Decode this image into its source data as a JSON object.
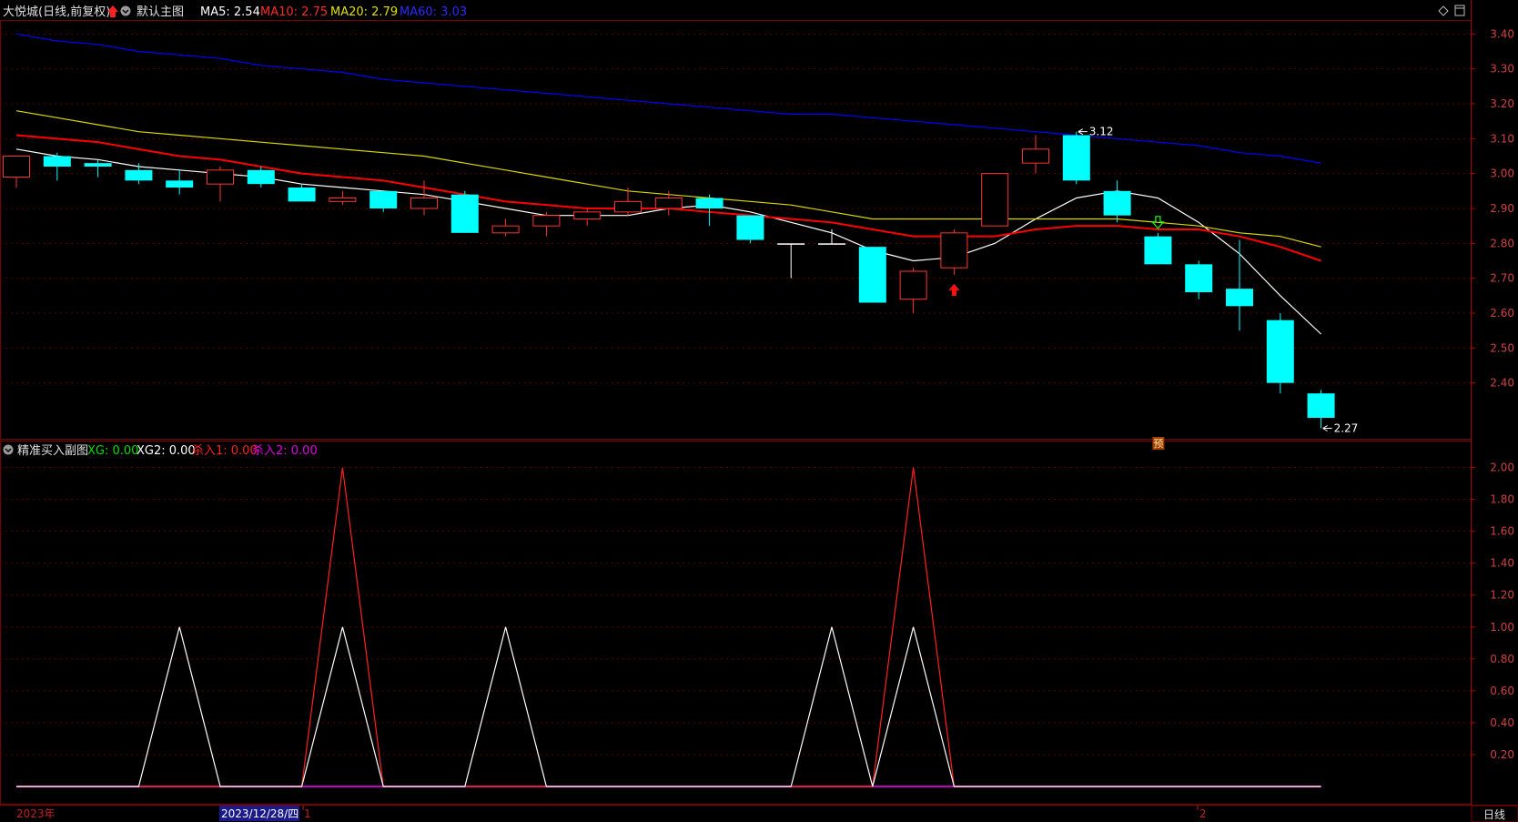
{
  "main_header": {
    "title": "大悦城(日线,前复权)",
    "indicator_name": "默认主图",
    "ma5": "MA5: 2.54",
    "ma10": "MA10: 2.75",
    "ma20": "MA20: 2.79",
    "ma60": "MA60: 3.03"
  },
  "sub_header": {
    "title": "精准买入副图",
    "xg": "XG: 0.00",
    "xg2": "XG2: 0.00",
    "sell1": "杀入1: 0.00",
    "sell2": "杀入2: 0.00"
  },
  "bottom_bar": {
    "year_label": "2023年",
    "date_label": "2023/12/28/四",
    "month1": "1",
    "month2": "2",
    "period_button": "日线"
  },
  "colors": {
    "up": "#ff3232",
    "down": "#00ffff",
    "ma5": "#ffffff",
    "ma10": "#ff0000",
    "ma20": "#d8d800",
    "ma60": "#0000ff",
    "axis": "#b00000",
    "sub_red": "#ff2020",
    "sub_white": "#ffffff",
    "sub_purple": "#c000c0"
  },
  "chart_data": [
    {
      "type": "candlestick",
      "title": "大悦城(日线,前复权)",
      "ylim": [
        2.24,
        3.44
      ],
      "y_ticks": [
        "3.40",
        "3.30",
        "3.20",
        "3.10",
        "3.00",
        "2.90",
        "2.80",
        "2.70",
        "2.60",
        "2.50",
        "2.40"
      ],
      "candles": [
        {
          "o": 2.99,
          "h": 3.01,
          "l": 2.96,
          "c": 3.05
        },
        {
          "o": 3.05,
          "h": 3.06,
          "l": 2.98,
          "c": 3.02
        },
        {
          "o": 3.03,
          "h": 3.04,
          "l": 2.99,
          "c": 3.02
        },
        {
          "o": 3.01,
          "h": 3.03,
          "l": 2.97,
          "c": 2.98
        },
        {
          "o": 2.98,
          "h": 3.01,
          "l": 2.94,
          "c": 2.96
        },
        {
          "o": 2.97,
          "h": 3.02,
          "l": 2.92,
          "c": 3.01
        },
        {
          "o": 3.01,
          "h": 3.02,
          "l": 2.96,
          "c": 2.97
        },
        {
          "o": 2.96,
          "h": 2.97,
          "l": 2.92,
          "c": 2.92
        },
        {
          "o": 2.92,
          "h": 2.95,
          "l": 2.91,
          "c": 2.93
        },
        {
          "o": 2.95,
          "h": 2.95,
          "l": 2.89,
          "c": 2.9
        },
        {
          "o": 2.9,
          "h": 2.98,
          "l": 2.88,
          "c": 2.93
        },
        {
          "o": 2.94,
          "h": 2.95,
          "l": 2.83,
          "c": 2.83
        },
        {
          "o": 2.83,
          "h": 2.87,
          "l": 2.82,
          "c": 2.85
        },
        {
          "o": 2.85,
          "h": 2.89,
          "l": 2.82,
          "c": 2.88
        },
        {
          "o": 2.87,
          "h": 2.9,
          "l": 2.85,
          "c": 2.89
        },
        {
          "o": 2.89,
          "h": 2.96,
          "l": 2.88,
          "c": 2.92
        },
        {
          "o": 2.9,
          "h": 2.95,
          "l": 2.88,
          "c": 2.93
        },
        {
          "o": 2.93,
          "h": 2.94,
          "l": 2.85,
          "c": 2.9
        },
        {
          "o": 2.88,
          "h": 2.88,
          "l": 2.8,
          "c": 2.81
        },
        {
          "o": 2.8,
          "h": 2.8,
          "l": 2.7,
          "c": 2.8
        },
        {
          "o": 2.8,
          "h": 2.84,
          "l": 2.8,
          "c": 2.8
        },
        {
          "o": 2.79,
          "h": 2.79,
          "l": 2.63,
          "c": 2.63
        },
        {
          "o": 2.64,
          "h": 2.73,
          "l": 2.6,
          "c": 2.72
        },
        {
          "o": 2.73,
          "h": 2.84,
          "l": 2.71,
          "c": 2.83
        },
        {
          "o": 2.85,
          "h": 3.0,
          "l": 2.85,
          "c": 3.0
        },
        {
          "o": 3.03,
          "h": 3.11,
          "l": 3.0,
          "c": 3.07
        },
        {
          "o": 3.11,
          "h": 3.12,
          "l": 2.97,
          "c": 2.98
        },
        {
          "o": 2.95,
          "h": 2.98,
          "l": 2.86,
          "c": 2.88
        },
        {
          "o": 2.82,
          "h": 2.83,
          "l": 2.74,
          "c": 2.74
        },
        {
          "o": 2.74,
          "h": 2.75,
          "l": 2.64,
          "c": 2.66
        },
        {
          "o": 2.67,
          "h": 2.81,
          "l": 2.55,
          "c": 2.62
        },
        {
          "o": 2.58,
          "h": 2.6,
          "l": 2.37,
          "c": 2.4
        },
        {
          "o": 2.37,
          "h": 2.38,
          "l": 2.27,
          "c": 2.3
        }
      ],
      "series": [
        {
          "name": "MA5",
          "values": [
            3.07,
            3.05,
            3.04,
            3.02,
            3.01,
            3.0,
            2.99,
            2.97,
            2.96,
            2.95,
            2.94,
            2.92,
            2.9,
            2.88,
            2.88,
            2.88,
            2.9,
            2.91,
            2.89,
            2.86,
            2.83,
            2.78,
            2.75,
            2.76,
            2.8,
            2.87,
            2.93,
            2.95,
            2.93,
            2.86,
            2.77,
            2.65,
            2.54
          ]
        },
        {
          "name": "MA10",
          "values": [
            3.11,
            3.1,
            3.09,
            3.07,
            3.05,
            3.04,
            3.02,
            3.0,
            2.99,
            2.98,
            2.96,
            2.94,
            2.92,
            2.91,
            2.9,
            2.9,
            2.9,
            2.89,
            2.88,
            2.87,
            2.86,
            2.84,
            2.82,
            2.82,
            2.82,
            2.84,
            2.85,
            2.85,
            2.84,
            2.84,
            2.82,
            2.79,
            2.75
          ]
        },
        {
          "name": "MA20",
          "values": [
            3.18,
            3.16,
            3.14,
            3.12,
            3.11,
            3.1,
            3.09,
            3.08,
            3.07,
            3.06,
            3.05,
            3.03,
            3.01,
            2.99,
            2.97,
            2.95,
            2.94,
            2.93,
            2.92,
            2.91,
            2.89,
            2.87,
            2.87,
            2.87,
            2.87,
            2.87,
            2.87,
            2.87,
            2.86,
            2.85,
            2.83,
            2.82,
            2.79
          ]
        },
        {
          "name": "MA60",
          "values": [
            3.4,
            3.38,
            3.37,
            3.35,
            3.34,
            3.33,
            3.31,
            3.3,
            3.29,
            3.27,
            3.26,
            3.25,
            3.24,
            3.23,
            3.22,
            3.21,
            3.2,
            3.19,
            3.18,
            3.17,
            3.17,
            3.16,
            3.15,
            3.14,
            3.13,
            3.12,
            3.11,
            3.1,
            3.09,
            3.08,
            3.06,
            3.05,
            3.03
          ]
        }
      ],
      "annotations": [
        {
          "text": "3.12",
          "candle": 26,
          "price": 3.12
        },
        {
          "text": "2.27",
          "candle": 32,
          "price": 2.27
        },
        {
          "text": "预",
          "candle": 28,
          "price": 2.24
        }
      ],
      "buy_arrows": [
        23
      ],
      "sell_arrows": [
        28
      ]
    },
    {
      "type": "line",
      "title": "精准买入副图",
      "ylim": [
        0,
        2.1
      ],
      "y_ticks": [
        "2.00",
        "1.80",
        "1.60",
        "1.40",
        "1.20",
        "1.00",
        "0.80",
        "0.60",
        "0.40",
        "0.20"
      ],
      "series": [
        {
          "name": "XG",
          "values": [
            0,
            0,
            0,
            0,
            1,
            0,
            0,
            0,
            1,
            0,
            0,
            0,
            1,
            0,
            0,
            0,
            0,
            0,
            0,
            0,
            1,
            0,
            1,
            0,
            0,
            0,
            0,
            0,
            0,
            0,
            0,
            0,
            0
          ]
        },
        {
          "name": "杀入1",
          "values": [
            0,
            0,
            0,
            0,
            0,
            0,
            0,
            0,
            2,
            0,
            0,
            0,
            0,
            0,
            0,
            0,
            0,
            0,
            0,
            0,
            0,
            0,
            2,
            0,
            0,
            0,
            0,
            0,
            0,
            0,
            0,
            0,
            0
          ]
        },
        {
          "name": "杀入2",
          "values": [
            0,
            0,
            0,
            0,
            0,
            0,
            0,
            0,
            0,
            0,
            0,
            0,
            0,
            0,
            0,
            0,
            0,
            0,
            0,
            0,
            0,
            0,
            0,
            0,
            0,
            0,
            0,
            0,
            0,
            0,
            0,
            0,
            0
          ]
        }
      ]
    }
  ]
}
